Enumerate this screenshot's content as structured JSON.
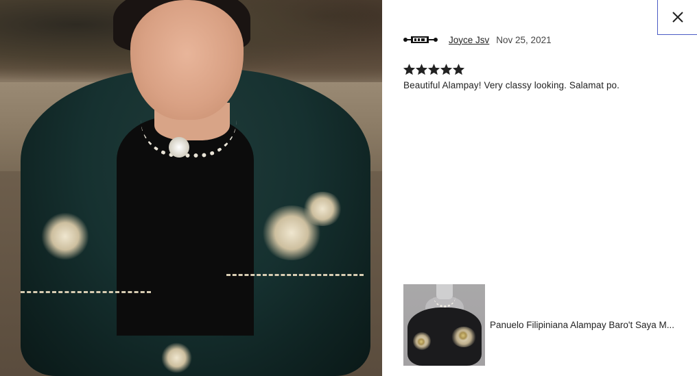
{
  "review": {
    "reviewer_name": "Joyce Jsv",
    "date": "Nov 25, 2021",
    "rating": 5,
    "rating_max": 5,
    "text": "Beautiful Alampay! Very classy looking. Salamat po."
  },
  "product": {
    "title": "Panuelo Filipiniana Alampay Baro't Saya M..."
  },
  "icons": {
    "close": "close-icon",
    "star": "star-icon",
    "avatar": "reviewer-avatar-logo"
  },
  "colors": {
    "close_border": "#4a5bc4",
    "text": "#222222",
    "star": "#222222"
  }
}
